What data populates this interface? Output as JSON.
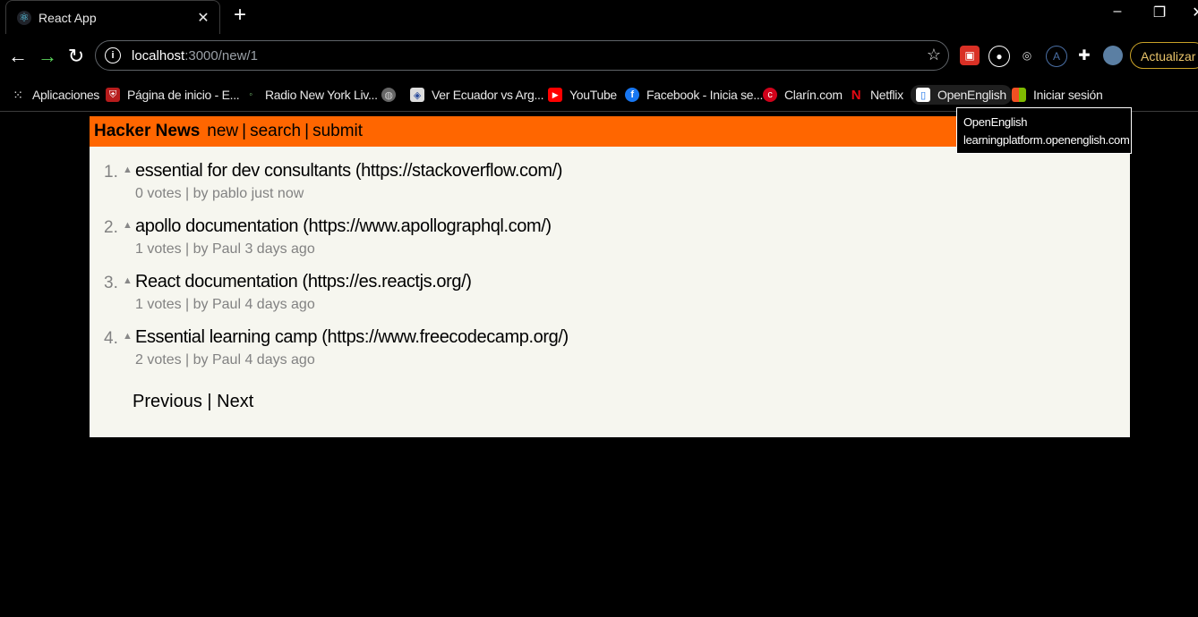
{
  "browser": {
    "tab_title": "React App",
    "tab_icon": "react-icon",
    "new_tab": "+",
    "url_host": "localhost",
    "url_path": ":3000/new/1",
    "update_label": "Actualizar",
    "accent": "#e9c46a"
  },
  "bookmarks": [
    {
      "label": "Aplicaciones",
      "icon": "apps-grid-icon"
    },
    {
      "label": "Página de inicio - E...",
      "icon": "shield-icon"
    },
    {
      "label": "Radio New York Liv...",
      "icon": "radio-icon"
    },
    {
      "label": "",
      "icon": "globe-icon"
    },
    {
      "label": "Ver Ecuador vs Arg...",
      "icon": "badge-icon"
    },
    {
      "label": "YouTube",
      "icon": "youtube-icon"
    },
    {
      "label": "Facebook - Inicia se...",
      "icon": "facebook-icon"
    },
    {
      "label": "Clarín.com",
      "icon": "clarin-icon"
    },
    {
      "label": "Netflix",
      "icon": "netflix-icon"
    },
    {
      "label": "OpenEnglish",
      "icon": "openenglish-icon"
    },
    {
      "label": "Iniciar sesión",
      "icon": "microsoft-icon"
    }
  ],
  "tooltip": {
    "title": "OpenEnglish",
    "url": "learningplatform.openenglish.com"
  },
  "hn": {
    "brand": "Hacker News",
    "nav": [
      "new",
      "search",
      "submit"
    ],
    "header_color": "#ff6600",
    "links": [
      {
        "rank": "1.",
        "title": "essential for dev consultants (https://stackoverflow.com/)",
        "meta": "0 votes | by pablo just now"
      },
      {
        "rank": "2.",
        "title": "apollo documentation (https://www.apollographql.com/)",
        "meta": "1 votes | by Paul 3 days ago"
      },
      {
        "rank": "3.",
        "title": "React documentation (https://es.reactjs.org/)",
        "meta": "1 votes | by Paul 4 days ago"
      },
      {
        "rank": "4.",
        "title": "Essential learning camp (https://www.freecodecamp.org/)",
        "meta": "2 votes | by Paul 4 days ago"
      }
    ],
    "pager": {
      "previous": "Previous",
      "separator": "|",
      "next": "Next"
    }
  }
}
